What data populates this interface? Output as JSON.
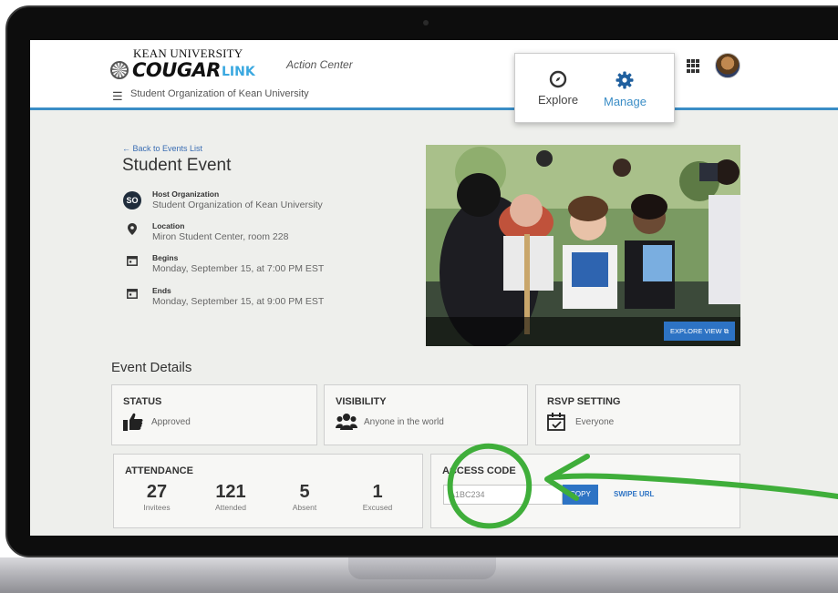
{
  "header": {
    "university": "KEAN UNIVERSITY",
    "brand_main": "COUGAR",
    "brand_link": "LINK",
    "section": "Action Center",
    "org_name": "Student Organization of Kean University"
  },
  "nav_popup": {
    "explore_label": "Explore",
    "manage_label": "Manage"
  },
  "event": {
    "back_link": "← Back to Events List",
    "title": "Student Event",
    "host_label": "Host Organization",
    "host_value": "Student Organization of Kean University",
    "host_badge": "SO",
    "location_label": "Location",
    "location_value": "Miron Student Center, room 228",
    "begins_label": "Begins",
    "begins_value": "Monday, September 15, at 7:00 PM EST",
    "ends_label": "Ends",
    "ends_value": "Monday, September 15, at 9:00 PM EST",
    "explore_view_label": "EXPLORE VIEW ⧉"
  },
  "details": {
    "section_title": "Event Details",
    "status_title": "STATUS",
    "status_value": "Approved",
    "visibility_title": "VISIBILITY",
    "visibility_value": "Anyone in the world",
    "rsvp_title": "RSVP SETTING",
    "rsvp_value": "Everyone",
    "attendance_title": "ATTENDANCE",
    "attendance": [
      {
        "num": "27",
        "label": "Invitees"
      },
      {
        "num": "121",
        "label": "Attended"
      },
      {
        "num": "5",
        "label": "Absent"
      },
      {
        "num": "1",
        "label": "Excused"
      }
    ],
    "access_title": "ACCESS CODE",
    "access_value": "A1BC234",
    "copy_label": "COPY",
    "swipe_label": "SWIPE URL"
  },
  "icons": {
    "explore": "compass-icon",
    "manage": "gear-icon",
    "apps": "grid-icon",
    "location": "map-pin-icon",
    "calendar": "calendar-icon",
    "status": "thumbs-up-icon",
    "visibility": "group-icon",
    "rsvp": "calendar-check-icon"
  },
  "colors": {
    "accent": "#2d73c4",
    "header_rule": "#3a8dc6",
    "annotation": "#3fae3a"
  }
}
